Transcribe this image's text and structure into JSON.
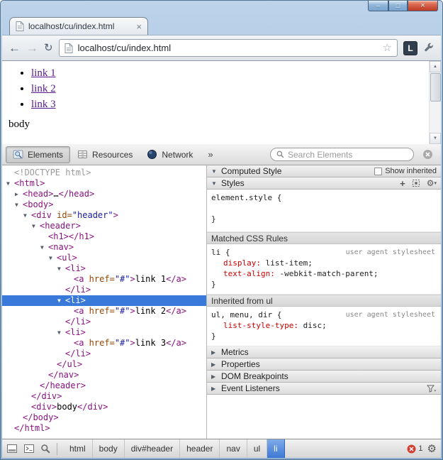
{
  "window": {
    "buttons": {
      "minimize": "–",
      "maximize": "□",
      "close": "×"
    }
  },
  "tab": {
    "title": "localhost/cu/index.html",
    "close_glyph": "×"
  },
  "toolbar": {
    "back_glyph": "←",
    "forward_glyph": "→",
    "reload_glyph": "↻",
    "url": "localhost/cu/index.html",
    "star_glyph": "☆",
    "extension_badge": "L"
  },
  "page": {
    "links": [
      "link 1",
      "link 2",
      "link 3"
    ],
    "body_text": "body",
    "link_color": "#551a8b"
  },
  "devtools": {
    "panels": [
      {
        "label": "Elements",
        "icon": "elements-icon",
        "active": true
      },
      {
        "label": "Resources",
        "icon": "resources-icon",
        "active": false
      },
      {
        "label": "Network",
        "icon": "network-icon",
        "active": false
      }
    ],
    "overflow_glyph": "»",
    "search_placeholder": "Search Elements",
    "dom_tree": [
      {
        "indent": 0,
        "arrow": null,
        "segs": [
          {
            "t": "<!DOCTYPE html>",
            "c": "doctype"
          }
        ]
      },
      {
        "indent": 0,
        "arrow": "down",
        "segs": [
          {
            "t": "<html>",
            "c": "tag"
          }
        ]
      },
      {
        "indent": 1,
        "arrow": "right",
        "segs": [
          {
            "t": "<head>",
            "c": "tag"
          },
          {
            "t": "…",
            "c": "text"
          },
          {
            "t": "</head>",
            "c": "tag"
          }
        ]
      },
      {
        "indent": 1,
        "arrow": "down",
        "segs": [
          {
            "t": "<body>",
            "c": "tag"
          }
        ]
      },
      {
        "indent": 2,
        "arrow": "down",
        "segs": [
          {
            "t": "<div",
            "c": "tag"
          },
          {
            "t": " id=",
            "c": "attr"
          },
          {
            "t": "\"header\"",
            "c": "val"
          },
          {
            "t": ">",
            "c": "tag"
          }
        ]
      },
      {
        "indent": 3,
        "arrow": "down",
        "segs": [
          {
            "t": "<header>",
            "c": "tag"
          }
        ]
      },
      {
        "indent": 4,
        "arrow": null,
        "segs": [
          {
            "t": "<h1>",
            "c": "tag"
          },
          {
            "t": "</h1>",
            "c": "tag"
          }
        ]
      },
      {
        "indent": 4,
        "arrow": "down",
        "segs": [
          {
            "t": "<nav>",
            "c": "tag"
          }
        ]
      },
      {
        "indent": 5,
        "arrow": "down",
        "segs": [
          {
            "t": "<ul>",
            "c": "tag"
          }
        ]
      },
      {
        "indent": 6,
        "arrow": "down",
        "segs": [
          {
            "t": "<li>",
            "c": "tag"
          }
        ]
      },
      {
        "indent": 7,
        "arrow": null,
        "segs": [
          {
            "t": "<a",
            "c": "tag"
          },
          {
            "t": " href=",
            "c": "attr"
          },
          {
            "t": "\"#\"",
            "c": "val"
          },
          {
            "t": ">",
            "c": "tag"
          },
          {
            "t": "link 1",
            "c": "text"
          },
          {
            "t": "</a>",
            "c": "tag"
          }
        ]
      },
      {
        "indent": 6,
        "arrow": null,
        "segs": [
          {
            "t": "</li>",
            "c": "tag"
          }
        ]
      },
      {
        "indent": 6,
        "arrow": "down",
        "selected": true,
        "segs": [
          {
            "t": "<li>",
            "c": "tag"
          }
        ]
      },
      {
        "indent": 7,
        "arrow": null,
        "segs": [
          {
            "t": "<a",
            "c": "tag"
          },
          {
            "t": " href=",
            "c": "attr"
          },
          {
            "t": "\"#\"",
            "c": "val"
          },
          {
            "t": ">",
            "c": "tag"
          },
          {
            "t": "link 2",
            "c": "text"
          },
          {
            "t": "</a>",
            "c": "tag"
          }
        ]
      },
      {
        "indent": 6,
        "arrow": null,
        "segs": [
          {
            "t": "</li>",
            "c": "tag"
          }
        ]
      },
      {
        "indent": 6,
        "arrow": "down",
        "segs": [
          {
            "t": "<li>",
            "c": "tag"
          }
        ]
      },
      {
        "indent": 7,
        "arrow": null,
        "segs": [
          {
            "t": "<a",
            "c": "tag"
          },
          {
            "t": " href=",
            "c": "attr"
          },
          {
            "t": "\"#\"",
            "c": "val"
          },
          {
            "t": ">",
            "c": "tag"
          },
          {
            "t": "link 3",
            "c": "text"
          },
          {
            "t": "</a>",
            "c": "tag"
          }
        ]
      },
      {
        "indent": 6,
        "arrow": null,
        "segs": [
          {
            "t": "</li>",
            "c": "tag"
          }
        ]
      },
      {
        "indent": 5,
        "arrow": null,
        "segs": [
          {
            "t": "</ul>",
            "c": "tag"
          }
        ]
      },
      {
        "indent": 4,
        "arrow": null,
        "segs": [
          {
            "t": "</nav>",
            "c": "tag"
          }
        ]
      },
      {
        "indent": 3,
        "arrow": null,
        "segs": [
          {
            "t": "</header>",
            "c": "tag"
          }
        ]
      },
      {
        "indent": 2,
        "arrow": null,
        "segs": [
          {
            "t": "</div>",
            "c": "tag"
          }
        ]
      },
      {
        "indent": 2,
        "arrow": null,
        "segs": [
          {
            "t": "<div>",
            "c": "tag"
          },
          {
            "t": "body",
            "c": "text"
          },
          {
            "t": "</div>",
            "c": "tag"
          }
        ]
      },
      {
        "indent": 1,
        "arrow": null,
        "segs": [
          {
            "t": "</body>",
            "c": "tag"
          }
        ]
      },
      {
        "indent": 0,
        "arrow": null,
        "segs": [
          {
            "t": "</html>",
            "c": "tag"
          }
        ]
      }
    ],
    "styles_pane": {
      "computed_header": "Computed Style",
      "show_inherited_label": "Show inherited",
      "styles_header": "Styles",
      "element_style_open": "element.style {",
      "element_style_close": "}",
      "sections": [
        {
          "header": "Matched CSS Rules",
          "rules": [
            {
              "selector": "li {",
              "origin": "user agent stylesheet",
              "props": [
                {
                  "name": "display",
                  "value": "list-item"
                },
                {
                  "name": "text-align",
                  "value": "-webkit-match-parent"
                }
              ],
              "close": "}"
            }
          ]
        },
        {
          "header": "Inherited from ul",
          "rules": [
            {
              "selector": "ul, menu, dir {",
              "origin": "user agent stylesheet",
              "props": [
                {
                  "name": "list-style-type",
                  "value": "disc"
                }
              ],
              "close": "}"
            }
          ]
        }
      ],
      "collapsed_sections": [
        {
          "label": "Metrics"
        },
        {
          "label": "Properties"
        },
        {
          "label": "DOM Breakpoints"
        },
        {
          "label": "Event Listeners",
          "has_filter": true
        }
      ]
    },
    "statusbar": {
      "breadcrumbs": [
        {
          "label": "html"
        },
        {
          "label": "body"
        },
        {
          "label": "div#header"
        },
        {
          "label": "header"
        },
        {
          "label": "nav"
        },
        {
          "label": "ul"
        },
        {
          "label": "li",
          "selected": true
        }
      ],
      "error_count": "1"
    }
  }
}
